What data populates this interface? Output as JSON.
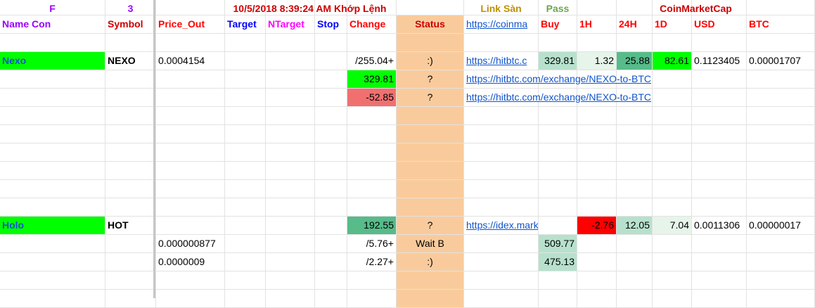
{
  "colors": {
    "status_column": "#f9cb9c",
    "bright_green": "#00ff00",
    "medium_green": "#57bb8a",
    "light_green": "#b7e1cd",
    "pale_green": "#e6f4ea",
    "salmon": "#f07070",
    "red": "#ff0000",
    "link": "#1155cc"
  },
  "header_row_1": {
    "f_label": "F",
    "count": "3",
    "timestamp": "10/5/2018 8:39:24 AM Khớp Lệnh",
    "link_san": "Link Sàn",
    "pass": "Pass",
    "coinmarketcap": "CoinMarketCap"
  },
  "columns": {
    "name_con": "Name Con",
    "symbol": "Symbol",
    "price_out": "Price_Out",
    "target": "Target",
    "ntarget": "NTarget",
    "stop": "Stop",
    "change": "Change",
    "status": "Status",
    "link": "https://coinma",
    "buy": "Buy",
    "h1": "1H",
    "h24": "24H",
    "d1": "1D",
    "usd": "USD",
    "btc": "BTC"
  },
  "nexo": {
    "name": "Nexo",
    "symbol": "NEXO",
    "price_out": "0.0004154",
    "change": "/255.04+",
    "status": ":)",
    "link": "https://hitbtc.c",
    "buy": "329.81",
    "h1": "1.32",
    "h24": "25.88",
    "d1": "82.61",
    "usd": "0.1123405",
    "btc": "0.00001707",
    "sub1": {
      "change": "329.81",
      "status": "?",
      "link": "https://hitbtc.com/exchange/NEXO-to-BTC"
    },
    "sub2": {
      "change": "-52.85",
      "status": "?",
      "link": "https://hitbtc.com/exchange/NEXO-to-BTC"
    }
  },
  "holo": {
    "name": "Holo",
    "symbol": "HOT",
    "change": "192.55",
    "status": "?",
    "link": "https://idex.market/eth",
    "h1": "-2.76",
    "h24": "12.05",
    "d1": "7.04",
    "usd": "0.0011306",
    "btc": "0.00000017",
    "sub1": {
      "price_out": "0.000000877",
      "change": "/5.76+",
      "status": "Wait B",
      "buy": "509.77"
    },
    "sub2": {
      "price_out": "0.0000009",
      "change": "/2.27+",
      "status": ":)",
      "buy": "475.13"
    }
  }
}
